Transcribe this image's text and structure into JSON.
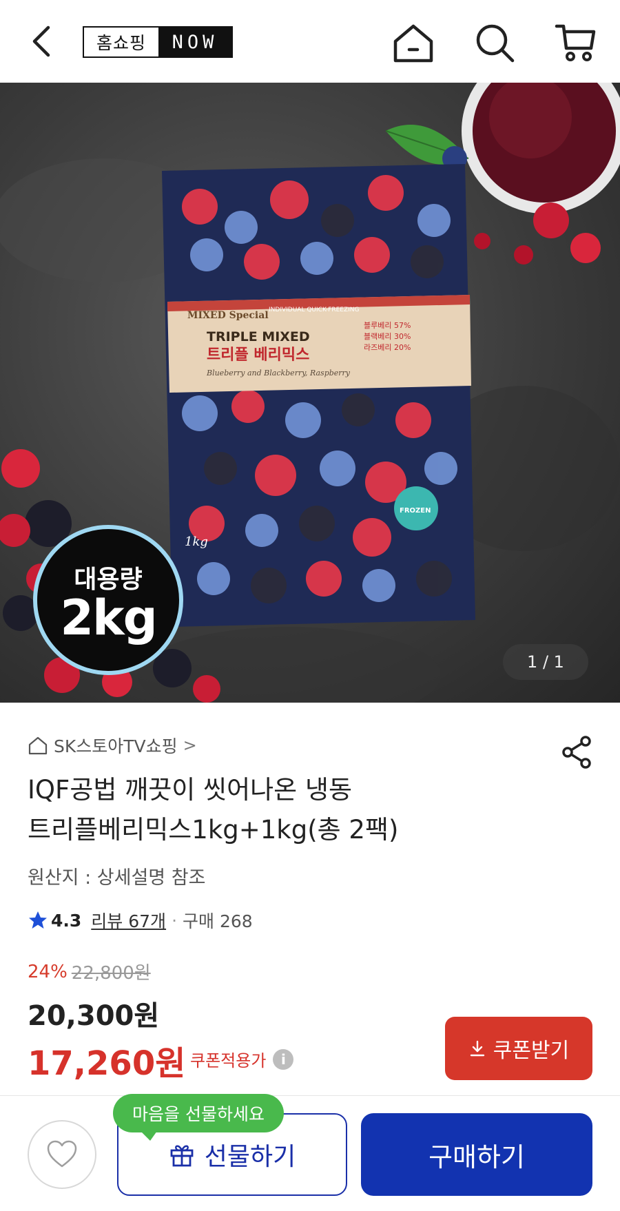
{
  "header": {
    "logo_part1": "홈쇼핑",
    "logo_part2": "NOW"
  },
  "hero": {
    "badge_line1": "대용량",
    "badge_line2": "2kg",
    "counter": "1 / 1",
    "package_label_tag": "MIXED Special",
    "package_label_sub": "INDIVIDUAL QUICK-FREEZING",
    "package_title_en": "TRIPLE MIXED",
    "package_title_ko": "트리플 베리믹스",
    "package_subtitle": "Blueberry and Blackberry, Raspberry",
    "package_ratio_1": "블루베리 57%",
    "package_ratio_2": "블랙베리 30%",
    "package_ratio_3": "라즈베리 20%",
    "package_weight": "1kg",
    "package_sticker": "FROZEN"
  },
  "product": {
    "seller": "SK스토아TV쇼핑",
    "seller_chevron": ">",
    "title_line1": "IQF공법 깨끗이 씻어나온 냉동",
    "title_line2": "트리플베리믹스1kg+1kg(총 2팩)",
    "origin": "원산지 : 상세설명 참조",
    "rating": "4.3",
    "reviews": "리뷰 67개",
    "dot": "·",
    "purchases": "구매 268"
  },
  "price": {
    "discount_pct": "24%",
    "original": "22,800원",
    "sale": "20,300원",
    "coupon_price": "17,260원",
    "coupon_label": "쿠폰적용가",
    "info_symbol": "i",
    "coupon_button": "쿠폰받기"
  },
  "bottom": {
    "tooltip": "마음을 선물하세요",
    "gift_button": "선물하기",
    "buy_button": "구매하기"
  },
  "colors": {
    "accent_red": "#d6322b",
    "primary_blue": "#1233b0",
    "tooltip_green": "#49b94c"
  }
}
